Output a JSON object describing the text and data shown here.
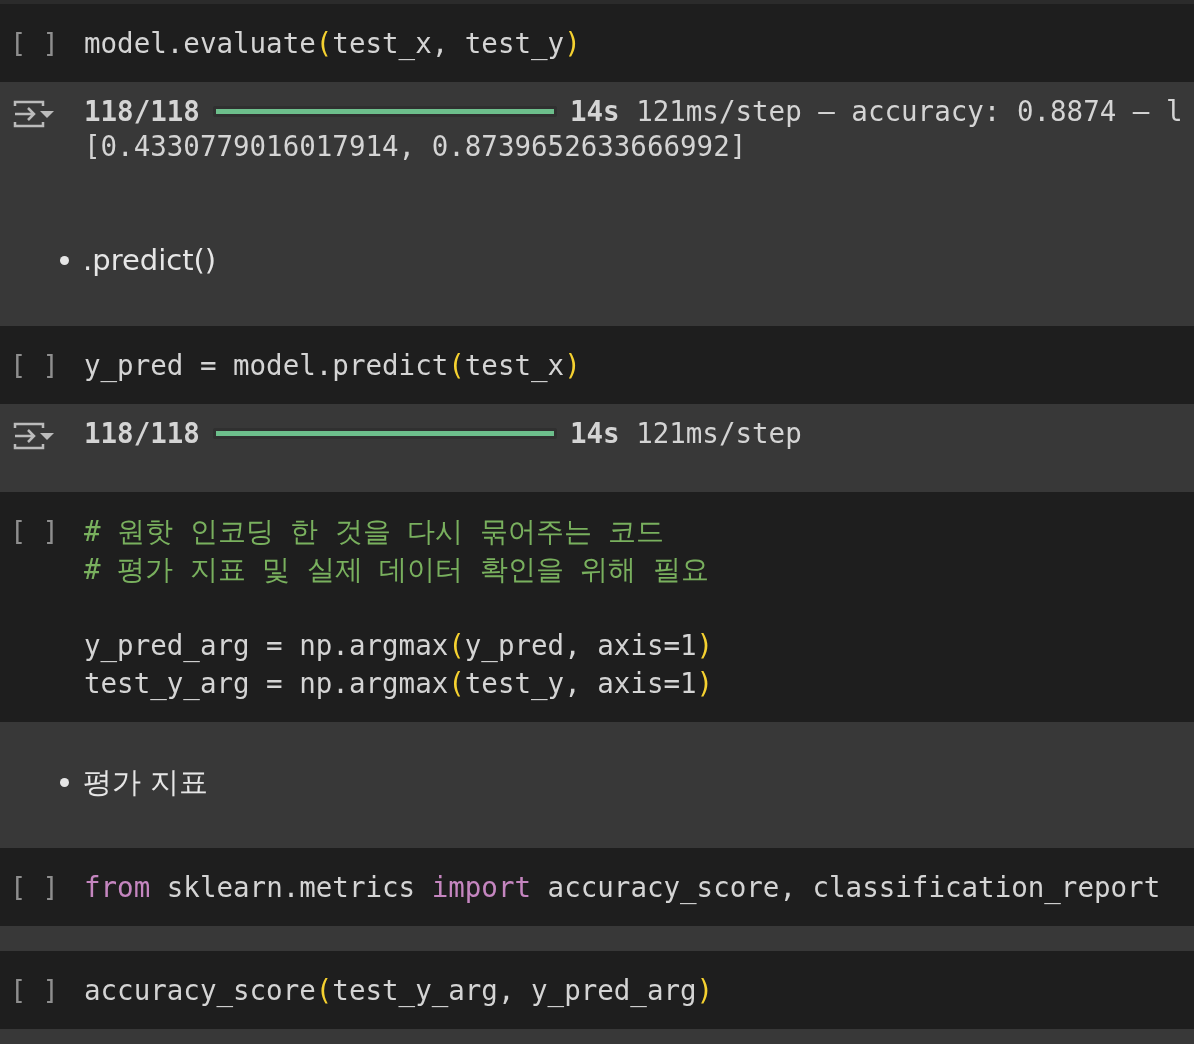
{
  "cells": [
    {
      "kind": "code",
      "bracket": "[ ]",
      "blocks": [
        [
          [
            {
              "t": "model.evaluate",
              "kind": "plain"
            },
            {
              "t": "(",
              "kind": "paren"
            },
            {
              "t": "test_x, test_y",
              "kind": "plain"
            },
            {
              "t": ")",
              "kind": "paren"
            }
          ]
        ]
      ],
      "output": {
        "lines": [
          {
            "kind": "progress",
            "count": "118/118",
            "level": 1,
            "time": "14s",
            "detail": "121ms/step – accuracy: 0.8874 – l"
          },
          {
            "kind": "text",
            "text": "[0.4330779016017914, 0.8739652633666992]"
          }
        ]
      }
    },
    {
      "kind": "markdown",
      "bullets": [
        ".predict()"
      ]
    },
    {
      "kind": "code",
      "bracket": "[ ]",
      "blocks": [
        [
          [
            {
              "t": "y_pred = model.predict",
              "kind": "plain"
            },
            {
              "t": "(",
              "kind": "paren"
            },
            {
              "t": "test_x",
              "kind": "plain"
            },
            {
              "t": ")",
              "kind": "paren"
            }
          ]
        ]
      ],
      "output": {
        "lines": [
          {
            "kind": "progress",
            "count": "118/118",
            "level": 1,
            "time": "14s",
            "detail": "121ms/step"
          }
        ]
      }
    },
    {
      "kind": "code",
      "bracket": "[ ]",
      "blocks": [
        [
          [
            {
              "t": "# 원핫 인코딩 한 것을 다시 묶어주는 코드",
              "kind": "comment"
            }
          ],
          [
            {
              "t": "# 평가 지표 및 실제 데이터 확인을 위해 필요",
              "kind": "comment"
            }
          ]
        ],
        [
          [
            {
              "t": "y_pred_arg = np.argmax",
              "kind": "plain"
            },
            {
              "t": "(",
              "kind": "paren"
            },
            {
              "t": "y_pred, axis=1",
              "kind": "plain"
            },
            {
              "t": ")",
              "kind": "paren"
            }
          ],
          [
            {
              "t": "test_y_arg = np.argmax",
              "kind": "plain"
            },
            {
              "t": "(",
              "kind": "paren"
            },
            {
              "t": "test_y, axis=1",
              "kind": "plain"
            },
            {
              "t": ")",
              "kind": "paren"
            }
          ]
        ]
      ]
    },
    {
      "kind": "markdown",
      "bullets": [
        "평가 지표"
      ]
    },
    {
      "kind": "code",
      "bracket": "[ ]",
      "blocks": [
        [
          [
            {
              "t": "from",
              "kind": "keyword"
            },
            {
              "t": " sklearn.metrics ",
              "kind": "plain"
            },
            {
              "t": "import",
              "kind": "keyword"
            },
            {
              "t": " accuracy_score, classification_report",
              "kind": "plain"
            }
          ]
        ]
      ]
    },
    {
      "kind": "code",
      "bracket": "[ ]",
      "blocks": [
        [
          [
            {
              "t": "accuracy_score",
              "kind": "plain"
            },
            {
              "t": "(",
              "kind": "paren"
            },
            {
              "t": "test_y_arg, y_pred_arg",
              "kind": "plain"
            },
            {
              "t": ")",
              "kind": "paren"
            }
          ]
        ]
      ]
    }
  ]
}
